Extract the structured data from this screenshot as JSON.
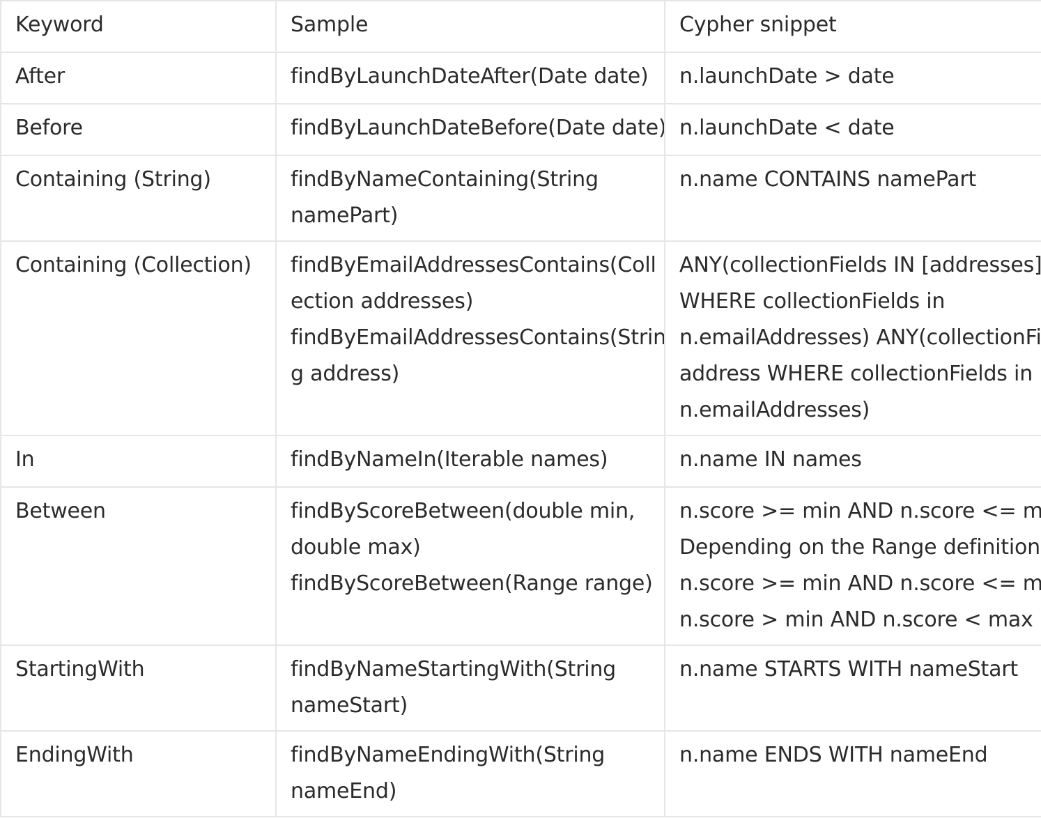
{
  "table": {
    "headers": [
      "Keyword",
      "Sample",
      "Cypher snippet"
    ],
    "rows": [
      {
        "keyword": [
          "After"
        ],
        "sample": [
          "findByLaunchDateAfter(Date date)"
        ],
        "cypher": [
          "n.launchDate > date"
        ]
      },
      {
        "keyword": [
          "Before"
        ],
        "sample": [
          "findByLaunchDateBefore(Date date)"
        ],
        "cypher": [
          "n.launchDate < date"
        ]
      },
      {
        "keyword": [
          "Containing (String)"
        ],
        "sample": [
          "findByNameContaining(String",
          "namePart)"
        ],
        "cypher": [
          "n.name CONTAINS namePart"
        ]
      },
      {
        "keyword": [
          "Containing (Collection)"
        ],
        "sample": [
          "findByEmailAddressesContains(Coll",
          "ection  addresses)",
          "findByEmailAddressesContains(Strin",
          "g  address)"
        ],
        "cypher": [
          "ANY(collectionFields IN [addresses]",
          "WHERE  collectionFields in",
          "n.emailAddresses) ANY(collectionFields IN",
          "address WHERE collectionFields  in",
          "n.emailAddresses)"
        ]
      },
      {
        "keyword": [
          "In"
        ],
        "sample": [
          "findByNameIn(Iterable  names)"
        ],
        "cypher": [
          "n.name IN names"
        ]
      },
      {
        "keyword": [
          "Between"
        ],
        "sample": [
          "findByScoreBetween(double min,",
          "double  max)",
          "findByScoreBetween(Range  range)"
        ],
        "cypher": [
          "n.score >= min AND n.score <=  max",
          "Depending on the Range definition",
          "n.score >=  min AND n.score <= max",
          "n.score > min AND n.score <  max"
        ]
      },
      {
        "keyword": [
          "StartingWith"
        ],
        "sample": [
          "findByNameStartingWith(String",
          " nameStart)"
        ],
        "cypher": [
          "n.name STARTS WITH nameStart"
        ]
      },
      {
        "keyword": [
          "EndingWith"
        ],
        "sample": [
          "findByNameEndingWith(String",
          "nameEnd)"
        ],
        "cypher": [
          "n.name ENDS WITH nameEnd"
        ]
      }
    ]
  }
}
